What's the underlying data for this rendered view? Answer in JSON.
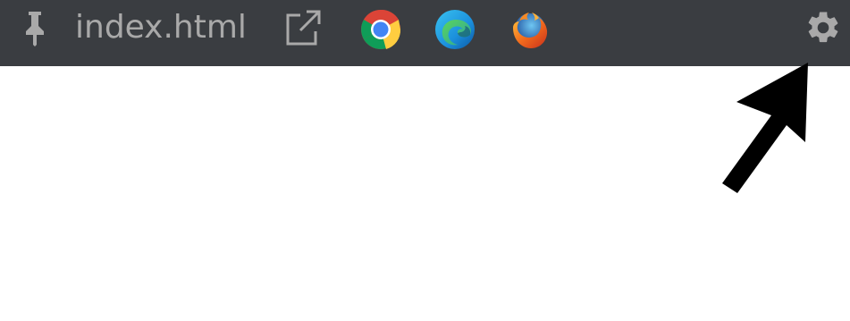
{
  "toolbar": {
    "filename": "index.html",
    "icons": [
      "pin-icon",
      "popout-icon",
      "chrome-icon",
      "edge-icon",
      "firefox-icon",
      "gear-icon"
    ],
    "background_color": "#3a3d41",
    "icon_color": "#a9a9a9"
  },
  "annotation": {
    "icon": "arrow-pointer-icon",
    "color": "#000000",
    "target": "settings-gear"
  }
}
